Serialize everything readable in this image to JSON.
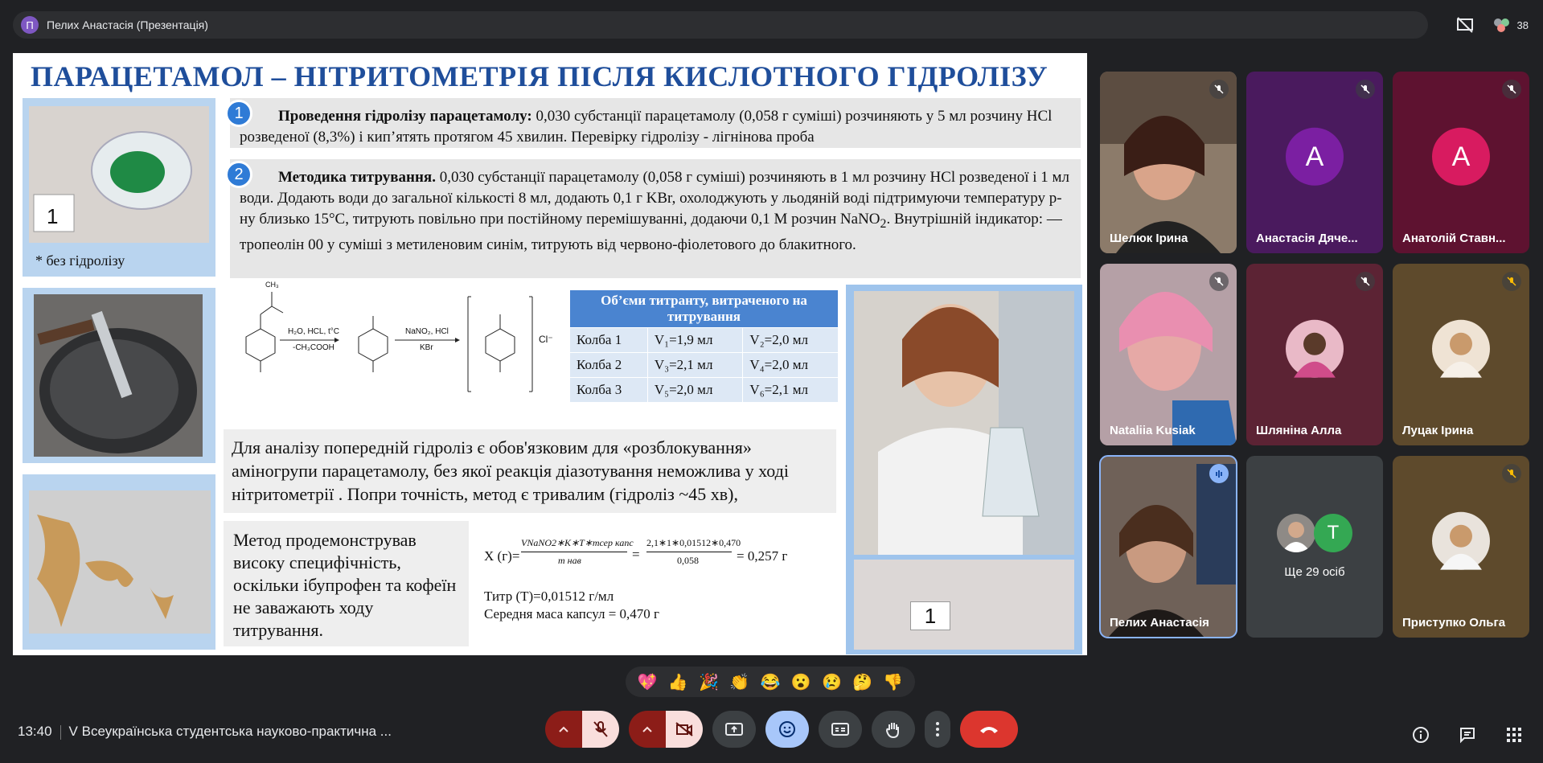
{
  "meeting": {
    "presenter_initial": "П",
    "presenter_title": "Пелих Анастасія (Презентація)",
    "participants_count": "38"
  },
  "slide": {
    "title": "ПАРАЦЕТАМОЛ – НІТРИТОМЕТРІЯ ПІСЛЯ КИСЛОТНОГО ГІДРОЛІЗУ",
    "step1_num": "1",
    "step1_lead": "Проведення гідролізу парацетамолу:",
    "step1_text": " 0,030 субстанції парацетамолу (0,058 г суміші) розчиняють у 5 мл розчину HCl розведеної (8,3%) і кип’ятять протягом 45 хвилин. Перевірку гідролізу - лігнінова проба",
    "step2_num": "2",
    "step2_lead": "Методика титрування.",
    "step2_text_a": " 0,030 субстанції парацетамолу (0,058 г суміші) розчиняють в 1 мл розчину HCl розведеної і 1 мл води. Додають води до загальної кількості 8 мл, додають 0,1 г KBr, охолоджують у льодяній воді підтримуючи температуру р-ну близько 15°C, титрують повільно при постійному перемішуванні, додаючи 0,1 М розчин NaNO",
    "step2_sub": "2",
    "step2_text_b": ". Внутрішній індикатор: —тропеолін 00 у суміші з метиленовим синім, титрують від червоно-фіолетового до блакитного.",
    "photo1_label": "1",
    "photo1_caption": "* без гідролізу",
    "reaction_arrow1_top": "H₂O, HCL, t°C",
    "reaction_arrow1_bottom": "-CH₃COOH",
    "reaction_arrow2_top": "NaNO₂, HCl",
    "reaction_arrow2_bottom": "KBr",
    "reaction_counterion": "Cl⁻",
    "reaction_substituent_top": "CH₃",
    "table_header": "Об’єми титранту, витраченого на титрування",
    "table_rows": [
      {
        "flask": "Колба 1",
        "a": "V₁=1,9 мл",
        "b": "V₂=2,0 мл"
      },
      {
        "flask": "Колба 2",
        "a": "V₃=2,1 мл",
        "b": "V₄=2,0 мл"
      },
      {
        "flask": "Колба 3",
        "a": "V₅=2,0 мл",
        "b": "V₆=2,1 мл"
      }
    ],
    "note1": "Для аналізу попередній гідроліз є обов'язковим для «розблокування» аміногрупи парацетамолу, без якої реакція діазотування неможлива у ході нітритометрії . Попри точність, метод є тривалим (гідроліз ~45 хв),",
    "note2": "Метод продемонстрував високу специфічність, оскільки ібупрофен та кофеїн не заважають ходу титрування.",
    "calc_lhs": "X (г)=",
    "calc_num": "VNaNO2∗K∗T∗mсер капс",
    "calc_den": "m нав",
    "calc_num2": "2,1∗1∗0,01512∗0,470",
    "calc_den2": "0,058",
    "calc_result": "= 0,257 г",
    "titr": "Титр (Т)=0,01512 г/мл",
    "mass": "Середня маса капсул = 0,470 г",
    "photo_bottom_label": "1"
  },
  "tiles": [
    {
      "name": "Шелюк Ірина",
      "initial": "",
      "color": "#6b5a4e"
    },
    {
      "name": "Анастасія Дяче...",
      "initial": "А",
      "color": "#6a1b9a"
    },
    {
      "name": "Анатолій Ставн...",
      "initial": "А",
      "color": "#c2185b"
    },
    {
      "name": "Natalіia Kusiak",
      "initial": "",
      "color": "#a37d83"
    },
    {
      "name": "Шляніна Алла",
      "initial": "",
      "color": "#7b3a4a"
    },
    {
      "name": "Луцак Ірина",
      "initial": "",
      "color": "#6d5a3a"
    },
    {
      "name": "Пелих Анастасія",
      "initial": "",
      "color": "#5b4e45"
    },
    {
      "name": "Ще 29 осіб",
      "initial": "Т",
      "color": "#3c4043"
    },
    {
      "name": "Приступко Ольга",
      "initial": "",
      "color": "#6d5a3a"
    }
  ],
  "reactions": [
    "💖",
    "👍",
    "🎉",
    "👏",
    "😂",
    "😮",
    "😢",
    "🤔",
    "👎"
  ],
  "bottom": {
    "time": "13:40",
    "meeting_name": "V Всеукраїнська студентська науково-практична ..."
  }
}
